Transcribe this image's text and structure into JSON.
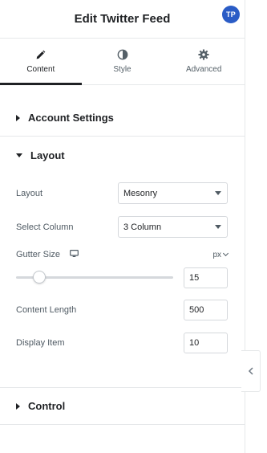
{
  "header": {
    "title": "Edit Twitter Feed",
    "badge": "TP"
  },
  "tabs": [
    {
      "label": "Content",
      "icon": "pencil-icon",
      "active": true
    },
    {
      "label": "Style",
      "icon": "contrast-icon",
      "active": false
    },
    {
      "label": "Advanced",
      "icon": "gear-icon",
      "active": false
    }
  ],
  "sections": {
    "account": {
      "label": "Account Settings"
    },
    "layout": {
      "label": "Layout"
    },
    "control": {
      "label": "Control"
    }
  },
  "layout": {
    "layout_field": {
      "label": "Layout",
      "value": "Mesonry"
    },
    "column_field": {
      "label": "Select Column",
      "value": "3 Column"
    },
    "gutter": {
      "label": "Gutter Size",
      "unit": "px",
      "value": "15",
      "slider_level": 15,
      "device_icon": "desktop-icon"
    },
    "content_length": {
      "label": "Content Length",
      "value": "500"
    },
    "display_item": {
      "label": "Display Item",
      "value": "10"
    }
  },
  "colors": {
    "accent": "#2a5cc6",
    "text": "#1f2124",
    "border": "#e6e8ea"
  }
}
